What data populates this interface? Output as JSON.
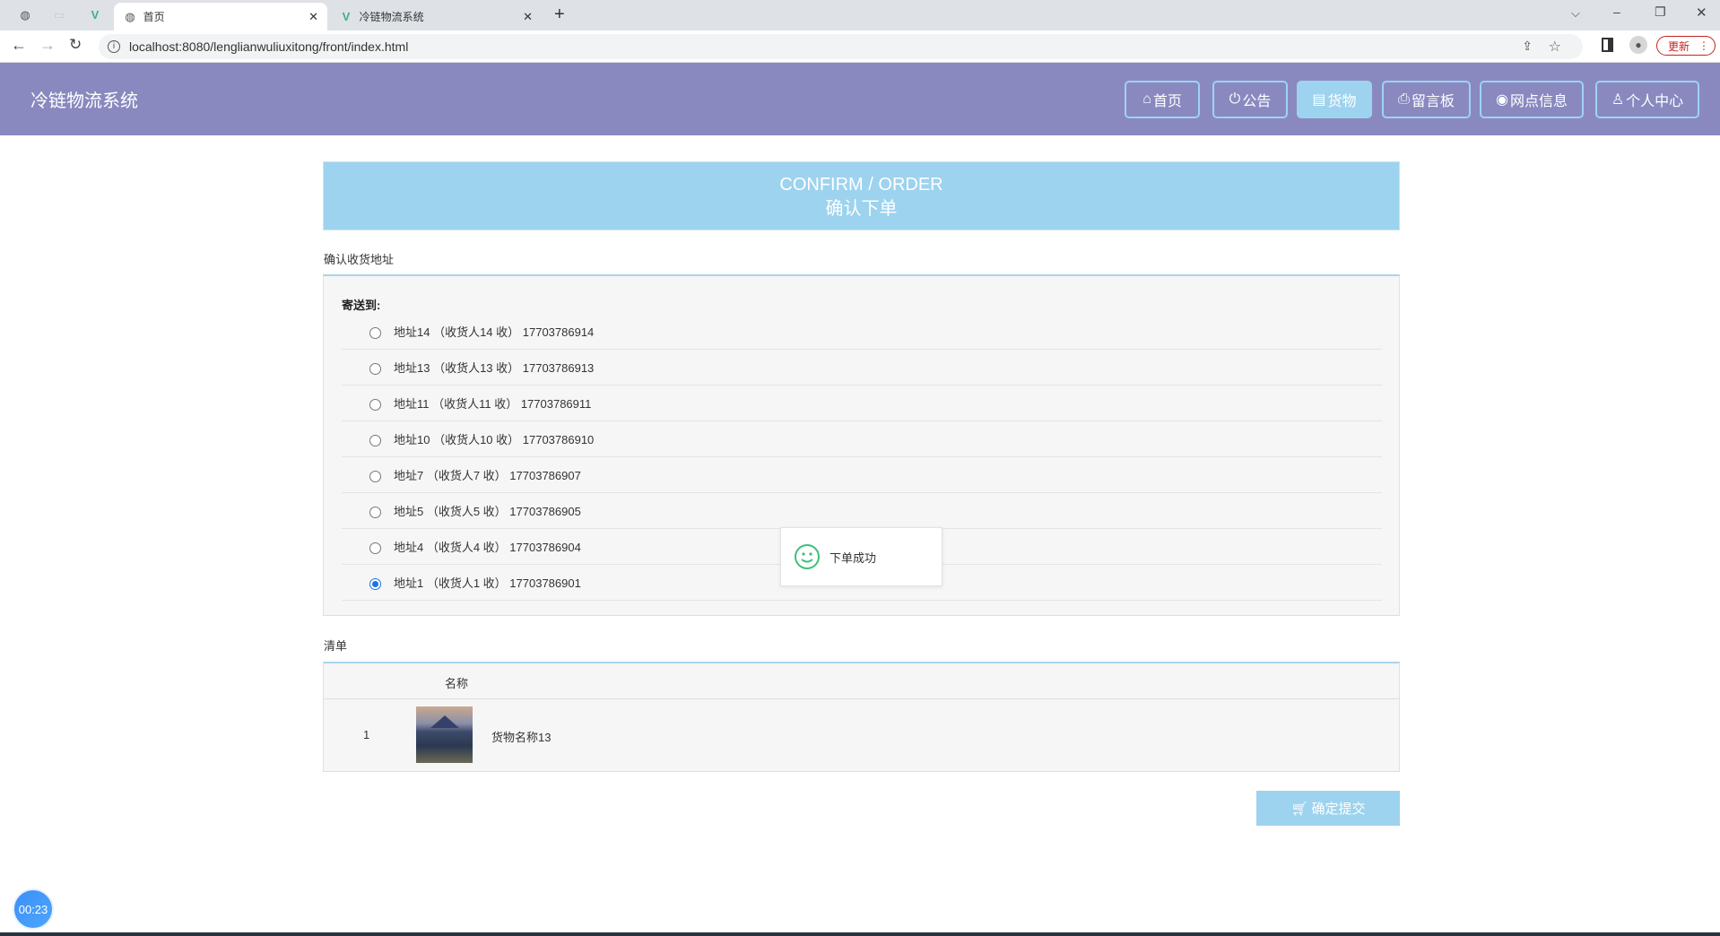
{
  "browser": {
    "tabs": [
      {
        "label": "首页",
        "active": true
      },
      {
        "label": "冷链物流系统",
        "active": false
      }
    ],
    "url": "localhost:8080/lenglianwuliuxitong/front/index.html",
    "update_label": "更新"
  },
  "header": {
    "title": "冷链物流系统",
    "nav": [
      {
        "label": "首页",
        "icon": "home-icon"
      },
      {
        "label": "公告",
        "icon": "power-icon"
      },
      {
        "label": "货物",
        "icon": "box-icon",
        "active": true
      },
      {
        "label": "留言板",
        "icon": "printer-icon"
      },
      {
        "label": "网点信息",
        "icon": "globe-icon"
      },
      {
        "label": "个人中心",
        "icon": "user-icon"
      }
    ]
  },
  "banner": {
    "en": "CONFIRM / ORDER",
    "zh": "确认下单"
  },
  "address_section": {
    "label": "确认收货地址",
    "send_to": "寄送到:",
    "addresses": [
      {
        "text": "地址14 （收货人14 收） 17703786914",
        "selected": false
      },
      {
        "text": "地址13 （收货人13 收） 17703786913",
        "selected": false
      },
      {
        "text": "地址11 （收货人11 收） 17703786911",
        "selected": false
      },
      {
        "text": "地址10 （收货人10 收） 17703786910",
        "selected": false
      },
      {
        "text": "地址7 （收货人7 收） 17703786907",
        "selected": false
      },
      {
        "text": "地址5 （收货人5 收） 17703786905",
        "selected": false
      },
      {
        "text": "地址4 （收货人4 收） 17703786904",
        "selected": false
      },
      {
        "text": "地址1 （收货人1 收） 17703786901",
        "selected": true
      }
    ]
  },
  "toast": {
    "message": "下单成功"
  },
  "list_section": {
    "label": "清单",
    "header_name": "名称",
    "rows": [
      {
        "index": "1",
        "name": "货物名称13"
      }
    ]
  },
  "submit_label": "确定提交",
  "timer": "00:23",
  "colors": {
    "header": "#8989c0",
    "accent": "#9dd3ee",
    "radio": "#1a73e8"
  }
}
